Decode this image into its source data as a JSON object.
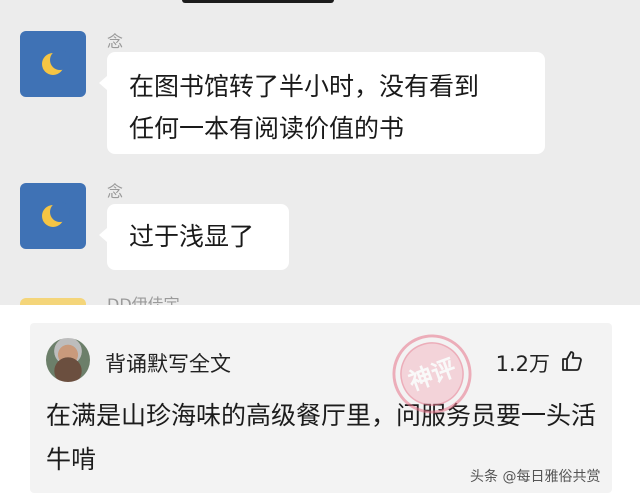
{
  "chat": {
    "messages": [
      {
        "sender": "念",
        "text_line1": "在图书馆转了半小时，没有看到",
        "text_line2": "任何一本有阅读价值的书"
      },
      {
        "sender": "念",
        "text_line1": "过于浅显了"
      }
    ],
    "partial_sender": "DD伊佳宇"
  },
  "comment": {
    "username": "背诵默写全文",
    "like_count": "1.2万",
    "text": "在满是山珍海味的高级餐厅里，问服务员要一头活牛啃",
    "stamp_label": "神评"
  },
  "watermark": "头条 @每日雅俗共赏",
  "colors": {
    "chat_background": "#ececec",
    "avatar_blue": "#3f72b5",
    "moon_yellow": "#f6c544",
    "stamp_pink": "#e7748a"
  }
}
